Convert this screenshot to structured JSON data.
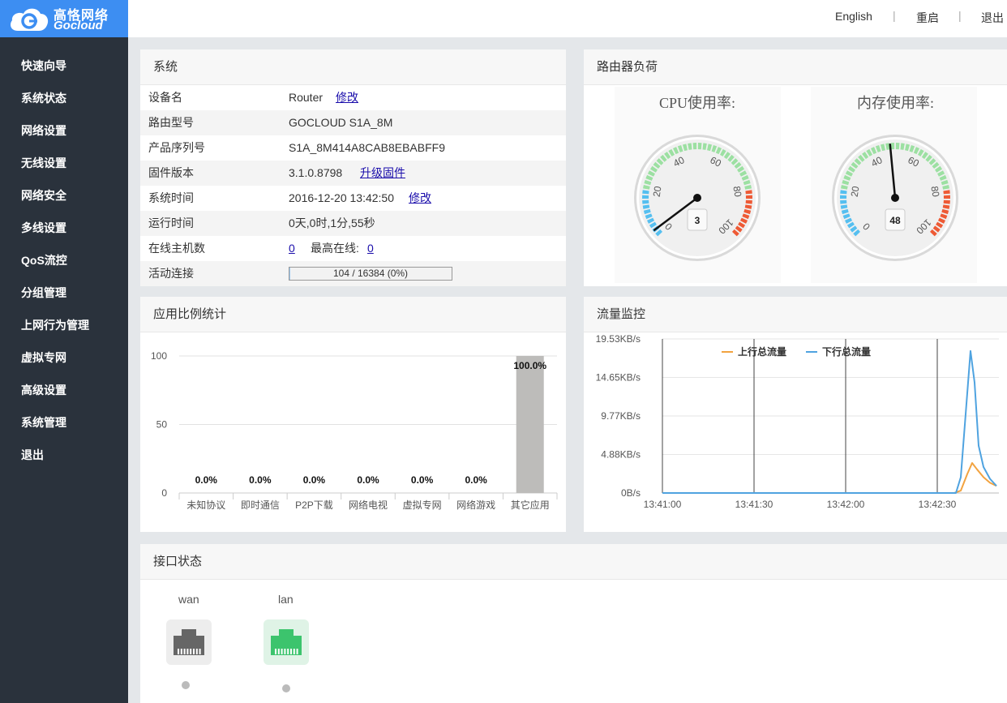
{
  "brand": {
    "cn": "高恪网络",
    "en": "Gocloud"
  },
  "menu": [
    "快速向导",
    "系统状态",
    "网络设置",
    "无线设置",
    "网络安全",
    "多线设置",
    "QoS流控",
    "分组管理",
    "上网行为管理",
    "虚拟专网",
    "高级设置",
    "系统管理",
    "退出"
  ],
  "topbar": {
    "lang": "English",
    "sep": "|",
    "reboot": "重启",
    "logout": "退出"
  },
  "system": {
    "title": "系统",
    "rows": [
      {
        "label": "设备名",
        "value": "Router",
        "link": "修改"
      },
      {
        "label": "路由型号",
        "value": "GOCLOUD S1A_8M"
      },
      {
        "label": "产品序列号",
        "value": "S1A_8M414A8CAB8EBABFF9"
      },
      {
        "label": "固件版本",
        "value": "3.1.0.8798",
        "link": "升级固件"
      },
      {
        "label": "系统时间",
        "value": "2016-12-20 13:42:50",
        "link": "修改"
      },
      {
        "label": "运行时间",
        "value": "0天,0时,1分,55秒"
      },
      {
        "label": "在线主机数",
        "value": "0",
        "extra_label": "最高在线:",
        "extra_value": "0"
      },
      {
        "label": "活动连接",
        "progress_text": "104 / 16384 (0%)",
        "progress_fraction": 0.0063
      }
    ]
  },
  "load": {
    "title": "路由器负荷",
    "cpu": {
      "title": "CPU使用率:",
      "value": 3
    },
    "mem": {
      "title": "内存使用率:",
      "value": 48
    },
    "ticks": [
      "0",
      "20",
      "40",
      "60",
      "80",
      "100"
    ]
  },
  "app_stats": {
    "title": "应用比例统计",
    "chart_data": {
      "type": "bar",
      "categories": [
        "未知协议",
        "即时通信",
        "P2P下载",
        "网络电视",
        "虚拟专网",
        "网络游戏",
        "其它应用"
      ],
      "values": [
        0.0,
        0.0,
        0.0,
        0.0,
        0.0,
        0.0,
        100.0
      ],
      "data_labels": [
        "0.0%",
        "0.0%",
        "0.0%",
        "0.0%",
        "0.0%",
        "0.0%",
        "100.0%"
      ],
      "yticks": [
        "0",
        "50",
        "100"
      ],
      "ylim": [
        0,
        100
      ],
      "color": "#bdbcba"
    }
  },
  "traffic": {
    "title": "流量监控",
    "chart_data": {
      "type": "line",
      "yticks": [
        "0B/s",
        "4.88KB/s",
        "9.77KB/s",
        "14.65KB/s",
        "19.53KB/s"
      ],
      "xticks": [
        "13:41:00",
        "13:41:30",
        "13:42:00",
        "13:42:30"
      ],
      "ylim_kbps": [
        0,
        19.53
      ],
      "series": [
        {
          "name": "上行总流量",
          "color": "#f2a340",
          "points": [
            [
              0,
              0
            ],
            [
              300,
              0
            ],
            [
              360,
              0
            ],
            [
              368,
              0.3
            ],
            [
              376,
              2.4
            ],
            [
              382,
              3.8
            ],
            [
              388,
              3.0
            ],
            [
              396,
              2.0
            ],
            [
              404,
              1.3
            ],
            [
              412,
              0.9
            ]
          ]
        },
        {
          "name": "下行总流量",
          "color": "#4fa3e0",
          "points": [
            [
              0,
              0
            ],
            [
              300,
              0
            ],
            [
              362,
              0
            ],
            [
              368,
              2.0
            ],
            [
              374,
              10.0
            ],
            [
              380,
              18.0
            ],
            [
              385,
              14.0
            ],
            [
              390,
              6.0
            ],
            [
              396,
              3.3
            ],
            [
              404,
              1.8
            ],
            [
              412,
              0.9
            ]
          ]
        }
      ]
    }
  },
  "ports": {
    "title": "接口状态",
    "items": [
      {
        "name": "wan",
        "status": "disconnected",
        "color": "#666666"
      },
      {
        "name": "lan",
        "status": "connected",
        "color": "#3cc46d"
      }
    ]
  }
}
